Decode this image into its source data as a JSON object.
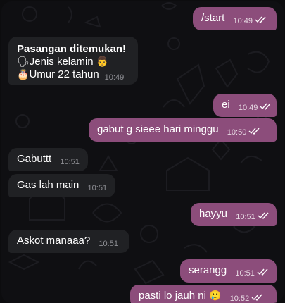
{
  "messages": [
    {
      "text": "/start",
      "time": "10:49"
    },
    {
      "title": "Pasangan ditemukan!",
      "line1_icon": "🗣",
      "line1": "Jenis kelamin",
      "line1_emoji": "👨",
      "line2_icon": "🎂",
      "line2": "Umur 22 tahun",
      "time": "10:49"
    },
    {
      "text": "ei",
      "time": "10:49"
    },
    {
      "text": "gabut g sieee hari minggu",
      "time": "10:50"
    },
    {
      "text": "Gabuttt",
      "time": "10:51"
    },
    {
      "text": "Gas lah main",
      "time": "10:51"
    },
    {
      "text": "hayyu",
      "time": "10:51"
    },
    {
      "text": "Askot manaaa?",
      "time": "10:51"
    },
    {
      "text": "serangg",
      "time": "10:51"
    },
    {
      "text": "pasti lo jauh ni",
      "emoji": "🥲",
      "time": "10:52"
    }
  ],
  "colors": {
    "outgoing_bubble": "#8c4d7b",
    "incoming_bubble": "#202124",
    "background": "#0f0f12"
  },
  "icons": [
    "double-check-icon",
    "doodle-pattern-icon"
  ]
}
